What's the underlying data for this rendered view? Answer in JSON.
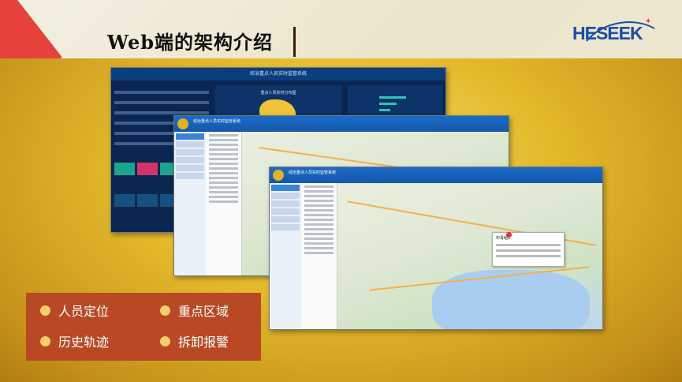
{
  "slide": {
    "title": "Web端的架构介绍",
    "logo": {
      "text": "HESEEK",
      "color": "#1a4fa8"
    },
    "colors": {
      "gold": "#e3b92a",
      "red": "#e6413a",
      "menu_bg": "#b84924"
    },
    "features": [
      {
        "label": "人员定位"
      },
      {
        "label": "重点区域"
      },
      {
        "label": "历史轨迹"
      },
      {
        "label": "拆卸报警"
      }
    ]
  },
  "screenshots": {
    "dashboard_title": "综治重点人员实时监管系统",
    "dashboard_map_title": "重点人员实时分布图",
    "app_title": "综治重点人员实时监管系统",
    "popup_title": "中青组1"
  }
}
